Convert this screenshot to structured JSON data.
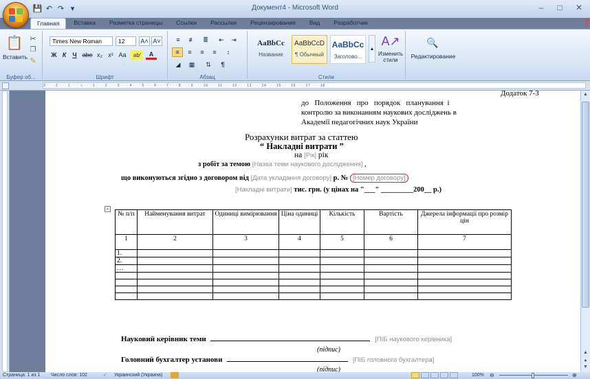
{
  "window": {
    "title": "Документ4 - Microsoft Word"
  },
  "tabs": [
    "Главная",
    "Вставка",
    "Разметка страницы",
    "Ссылки",
    "Рассылки",
    "Рецензирование",
    "Вид",
    "Разработчик"
  ],
  "ribbon": {
    "paste_label": "Вставить",
    "clipboard_label": "Буфер об...",
    "font_label": "Шрифт",
    "paragraph_label": "Абзац",
    "styles_label": "Стили",
    "editing_label": "Редактирование",
    "font_name": "Times New Roman",
    "font_size": "12",
    "change_styles_label": "Изменить стили",
    "styles": [
      {
        "sample": "AaBbCc",
        "name": "Название"
      },
      {
        "sample": "AaBbCcD",
        "name": "¶ Обычный"
      },
      {
        "sample": "AaBbCc",
        "name": "Заголово..."
      }
    ]
  },
  "ruler": {
    "text": "3 · · · 2 · · · 1 · · · ⌂ · · · 1 · · · 2 · · · 3 · · · 4 · · · 5 · · · 6 · · · 7 · · · 8 · · · 9 · · · 10 · · · 11 · · · 12 · · · 13 · · · 14 · · · 15 · · · 16 · · · 17 · · · 18 ·"
  },
  "document": {
    "appendix_title": "Додаток 7-3",
    "appendix_l1": "до   Положення   про   порядок   планування  і",
    "appendix_l2": "контролю за виконанням наукових досліджень в",
    "appendix_l3": "Академії педагогічних наук України",
    "calc_title": "Розрахунки витрат за статтею",
    "item_title": "“ Накладні витрати ”",
    "on_label": "на",
    "year_ph": "[Рік]",
    "year_label": "рік",
    "works_label": "з робіт  за темою",
    "topic_ph": "[Назва теми наукового дослідження]",
    "topic_suffix": ",",
    "contract_label": "що виконуються згідно з договором від",
    "date_ph": "[Дата укладання договору]",
    "contract_no_label": "р. №",
    "number_ph": "[Номер договору]",
    "overhead_ph": "[Накладні витрати]",
    "price_label": "тис. грн. (у цінах на \"___\" _________200__ р.)",
    "table_headers": [
      "№ п/п",
      "Найменування витрат",
      "Одиниці вимірювання",
      "Ціна одиниці",
      "Кількість",
      "Вартість",
      "Джерела інформації про розмір цін"
    ],
    "table_numbers": [
      "1",
      "2",
      "3",
      "4",
      "5",
      "6",
      "7"
    ],
    "table_rows": [
      "1.",
      "2.",
      "…",
      "",
      "",
      "",
      ""
    ],
    "head_label": "Науковий керівник теми",
    "head_ph": "[ПІБ наукового керівника]",
    "signature_label": "(підпис)",
    "accountant_label": "Головний бухгалтер установи",
    "accountant_ph": "[ПІБ головного бухгалтера]",
    "signature_label2": "(підпис)"
  },
  "status": {
    "page": "Страница: 1 из 1",
    "words": "Число слов: 102",
    "language": "Украинский (Украина)",
    "zoom": "100%"
  },
  "colors": {
    "highlight_circle": "#c0282d",
    "ribbon_accent": "#dbe7f5"
  }
}
